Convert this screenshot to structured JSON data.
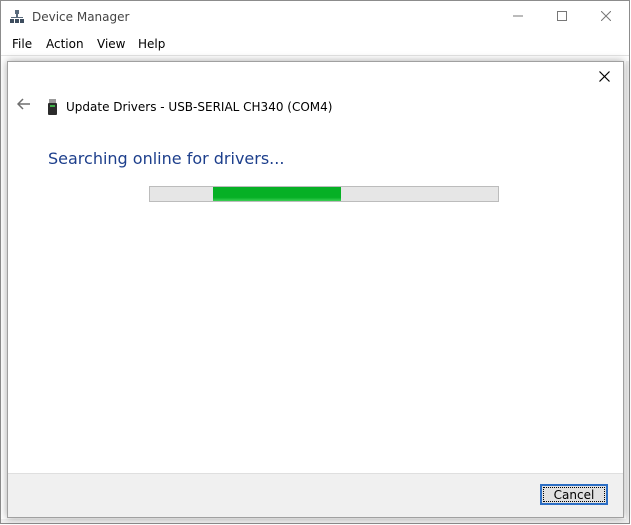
{
  "window": {
    "title": "Device Manager",
    "app_icon": "device-manager-icon",
    "controls": [
      "minimize-icon",
      "maximize-icon",
      "close-icon"
    ]
  },
  "menu": [
    "File",
    "Action",
    "View",
    "Help"
  ],
  "dialog": {
    "title": "Update Drivers - USB-SERIAL CH340 (COM4)",
    "status": "Searching online for drivers...",
    "progress": {
      "state": "indeterminate",
      "start_fraction": 0.18,
      "end_fraction": 0.55,
      "color": "#06b025"
    },
    "cancel_label": "Cancel",
    "icons": {
      "back": "back-arrow-icon",
      "close": "close-icon",
      "device": "usb-device-icon"
    }
  },
  "colors": {
    "status_text": "#1d3f8c",
    "focus_border": "#2c6ec4",
    "progress_green": "#06b025"
  }
}
